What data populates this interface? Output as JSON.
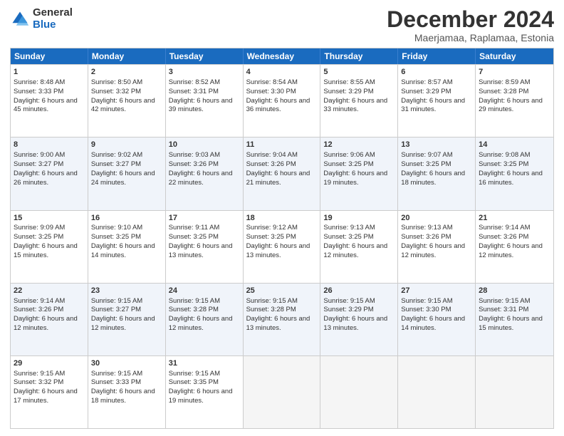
{
  "logo": {
    "general": "General",
    "blue": "Blue"
  },
  "title": "December 2024",
  "subtitle": "Maerjamaa, Raplamaa, Estonia",
  "days": [
    "Sunday",
    "Monday",
    "Tuesday",
    "Wednesday",
    "Thursday",
    "Friday",
    "Saturday"
  ],
  "weeks": [
    [
      {
        "day": 1,
        "sun": "Sunrise: 8:48 AM",
        "set": "Sunset: 3:33 PM",
        "day_text": "Daylight: 6 hours and 45 minutes."
      },
      {
        "day": 2,
        "sun": "Sunrise: 8:50 AM",
        "set": "Sunset: 3:32 PM",
        "day_text": "Daylight: 6 hours and 42 minutes."
      },
      {
        "day": 3,
        "sun": "Sunrise: 8:52 AM",
        "set": "Sunset: 3:31 PM",
        "day_text": "Daylight: 6 hours and 39 minutes."
      },
      {
        "day": 4,
        "sun": "Sunrise: 8:54 AM",
        "set": "Sunset: 3:30 PM",
        "day_text": "Daylight: 6 hours and 36 minutes."
      },
      {
        "day": 5,
        "sun": "Sunrise: 8:55 AM",
        "set": "Sunset: 3:29 PM",
        "day_text": "Daylight: 6 hours and 33 minutes."
      },
      {
        "day": 6,
        "sun": "Sunrise: 8:57 AM",
        "set": "Sunset: 3:29 PM",
        "day_text": "Daylight: 6 hours and 31 minutes."
      },
      {
        "day": 7,
        "sun": "Sunrise: 8:59 AM",
        "set": "Sunset: 3:28 PM",
        "day_text": "Daylight: 6 hours and 29 minutes."
      }
    ],
    [
      {
        "day": 8,
        "sun": "Sunrise: 9:00 AM",
        "set": "Sunset: 3:27 PM",
        "day_text": "Daylight: 6 hours and 26 minutes."
      },
      {
        "day": 9,
        "sun": "Sunrise: 9:02 AM",
        "set": "Sunset: 3:27 PM",
        "day_text": "Daylight: 6 hours and 24 minutes."
      },
      {
        "day": 10,
        "sun": "Sunrise: 9:03 AM",
        "set": "Sunset: 3:26 PM",
        "day_text": "Daylight: 6 hours and 22 minutes."
      },
      {
        "day": 11,
        "sun": "Sunrise: 9:04 AM",
        "set": "Sunset: 3:26 PM",
        "day_text": "Daylight: 6 hours and 21 minutes."
      },
      {
        "day": 12,
        "sun": "Sunrise: 9:06 AM",
        "set": "Sunset: 3:25 PM",
        "day_text": "Daylight: 6 hours and 19 minutes."
      },
      {
        "day": 13,
        "sun": "Sunrise: 9:07 AM",
        "set": "Sunset: 3:25 PM",
        "day_text": "Daylight: 6 hours and 18 minutes."
      },
      {
        "day": 14,
        "sun": "Sunrise: 9:08 AM",
        "set": "Sunset: 3:25 PM",
        "day_text": "Daylight: 6 hours and 16 minutes."
      }
    ],
    [
      {
        "day": 15,
        "sun": "Sunrise: 9:09 AM",
        "set": "Sunset: 3:25 PM",
        "day_text": "Daylight: 6 hours and 15 minutes."
      },
      {
        "day": 16,
        "sun": "Sunrise: 9:10 AM",
        "set": "Sunset: 3:25 PM",
        "day_text": "Daylight: 6 hours and 14 minutes."
      },
      {
        "day": 17,
        "sun": "Sunrise: 9:11 AM",
        "set": "Sunset: 3:25 PM",
        "day_text": "Daylight: 6 hours and 13 minutes."
      },
      {
        "day": 18,
        "sun": "Sunrise: 9:12 AM",
        "set": "Sunset: 3:25 PM",
        "day_text": "Daylight: 6 hours and 13 minutes."
      },
      {
        "day": 19,
        "sun": "Sunrise: 9:13 AM",
        "set": "Sunset: 3:25 PM",
        "day_text": "Daylight: 6 hours and 12 minutes."
      },
      {
        "day": 20,
        "sun": "Sunrise: 9:13 AM",
        "set": "Sunset: 3:26 PM",
        "day_text": "Daylight: 6 hours and 12 minutes."
      },
      {
        "day": 21,
        "sun": "Sunrise: 9:14 AM",
        "set": "Sunset: 3:26 PM",
        "day_text": "Daylight: 6 hours and 12 minutes."
      }
    ],
    [
      {
        "day": 22,
        "sun": "Sunrise: 9:14 AM",
        "set": "Sunset: 3:26 PM",
        "day_text": "Daylight: 6 hours and 12 minutes."
      },
      {
        "day": 23,
        "sun": "Sunrise: 9:15 AM",
        "set": "Sunset: 3:27 PM",
        "day_text": "Daylight: 6 hours and 12 minutes."
      },
      {
        "day": 24,
        "sun": "Sunrise: 9:15 AM",
        "set": "Sunset: 3:28 PM",
        "day_text": "Daylight: 6 hours and 12 minutes."
      },
      {
        "day": 25,
        "sun": "Sunrise: 9:15 AM",
        "set": "Sunset: 3:28 PM",
        "day_text": "Daylight: 6 hours and 13 minutes."
      },
      {
        "day": 26,
        "sun": "Sunrise: 9:15 AM",
        "set": "Sunset: 3:29 PM",
        "day_text": "Daylight: 6 hours and 13 minutes."
      },
      {
        "day": 27,
        "sun": "Sunrise: 9:15 AM",
        "set": "Sunset: 3:30 PM",
        "day_text": "Daylight: 6 hours and 14 minutes."
      },
      {
        "day": 28,
        "sun": "Sunrise: 9:15 AM",
        "set": "Sunset: 3:31 PM",
        "day_text": "Daylight: 6 hours and 15 minutes."
      }
    ],
    [
      {
        "day": 29,
        "sun": "Sunrise: 9:15 AM",
        "set": "Sunset: 3:32 PM",
        "day_text": "Daylight: 6 hours and 17 minutes."
      },
      {
        "day": 30,
        "sun": "Sunrise: 9:15 AM",
        "set": "Sunset: 3:33 PM",
        "day_text": "Daylight: 6 hours and 18 minutes."
      },
      {
        "day": 31,
        "sun": "Sunrise: 9:15 AM",
        "set": "Sunset: 3:35 PM",
        "day_text": "Daylight: 6 hours and 19 minutes."
      },
      null,
      null,
      null,
      null
    ]
  ]
}
